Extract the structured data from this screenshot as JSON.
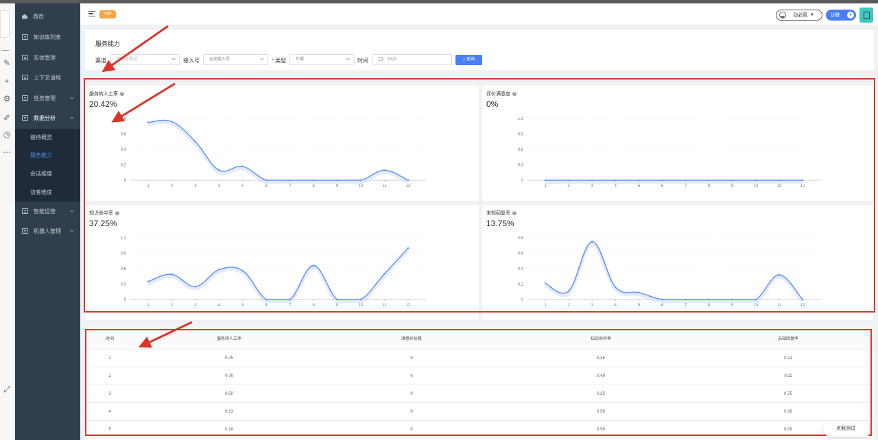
{
  "header": {
    "vip_badge": "VIP",
    "user_name": "动必真",
    "train_label": "训练",
    "train_knob": "★"
  },
  "sidebar": {
    "items": [
      {
        "label": "首页"
      },
      {
        "label": "知识库列表"
      },
      {
        "label": "实体管理"
      },
      {
        "label": "上下文语境"
      },
      {
        "label": "任务管理"
      },
      {
        "label": "数据分析"
      },
      {
        "label": "智能运营"
      },
      {
        "label": "机器人管理"
      }
    ],
    "sub_items": [
      {
        "label": "接待概览"
      },
      {
        "label": "服务能力"
      },
      {
        "label": "会话维度"
      },
      {
        "label": "访客维度"
      }
    ]
  },
  "filter": {
    "title": "服务能力",
    "channel_label": "渠道",
    "channel_placeholder": "请选择渠道",
    "access_label": "接入号",
    "access_value": "全部接入号",
    "type_required": "*",
    "type_label": "类型",
    "type_value": "年报",
    "time_label": "时间",
    "time_value": "2023",
    "query_label": "查询",
    "query_icon": "⌕"
  },
  "charts": [
    {
      "title": "服务转人工率",
      "value": "20.42%",
      "help_icon": "?"
    },
    {
      "title": "评价满意度",
      "value": "0%",
      "help_icon": "?"
    },
    {
      "title": "知识命中率",
      "value": "37.25%",
      "help_icon": "?"
    },
    {
      "title": "未知回复率",
      "value": "13.75%",
      "help_icon": "?"
    }
  ],
  "chart_data": [
    {
      "type": "line",
      "x": [
        1,
        2,
        3,
        4,
        5,
        6,
        7,
        8,
        9,
        10,
        11,
        12
      ],
      "values": [
        0.75,
        0.76,
        0.5,
        0.13,
        0.18,
        0,
        0,
        0,
        0,
        0,
        0.13,
        0
      ],
      "yticks": [
        0,
        0.2,
        0.4,
        0.6,
        0.8
      ],
      "ylim": [
        0,
        0.8
      ],
      "color": "#5b8ff9"
    },
    {
      "type": "line",
      "x": [
        1,
        2,
        3,
        4,
        5,
        6,
        7,
        8,
        9,
        10,
        11,
        12
      ],
      "values": [
        0,
        0,
        0,
        0,
        0,
        0,
        0,
        0,
        0,
        0,
        0,
        0
      ],
      "yticks": [
        0,
        0.3,
        0.6,
        0.9,
        1.2
      ],
      "ylim": [
        0,
        1.2
      ],
      "color": "#5b8ff9"
    },
    {
      "type": "line",
      "x": [
        1,
        2,
        3,
        4,
        5,
        6,
        7,
        8,
        9,
        10,
        11,
        12
      ],
      "values": [
        0.35,
        0.49,
        0.25,
        0.58,
        0.56,
        0,
        0,
        0.66,
        0,
        0,
        0.5,
        1.0
      ],
      "yticks": [
        0,
        0.3,
        0.6,
        0.9,
        1.2
      ],
      "ylim": [
        0,
        1.2
      ],
      "color": "#5b8ff9"
    },
    {
      "type": "line",
      "x": [
        1,
        2,
        3,
        4,
        5,
        6,
        7,
        8,
        9,
        10,
        11,
        12
      ],
      "values": [
        0.21,
        0.11,
        0.75,
        0.16,
        0.09,
        0,
        0,
        0,
        0,
        0,
        0.32,
        0
      ],
      "yticks": [
        0,
        0.2,
        0.4,
        0.6,
        0.8
      ],
      "ylim": [
        0,
        0.8
      ],
      "color": "#5b8ff9"
    }
  ],
  "table": {
    "headers": [
      "时间",
      "服务转人工率",
      "满意评价数",
      "知识命中率",
      "未知回复率"
    ],
    "rows": [
      [
        "1",
        "0.75",
        "0",
        "0.35",
        "0.21"
      ],
      [
        "2",
        "0.76",
        "0",
        "0.49",
        "0.11"
      ],
      [
        "3",
        "0.50",
        "0",
        "0.25",
        "0.75"
      ],
      [
        "4",
        "0.13",
        "0",
        "0.58",
        "0.16"
      ],
      [
        "5",
        "0.18",
        "0",
        "0.56",
        "0.09"
      ]
    ]
  },
  "float_button": "点我测试",
  "colors": {
    "accent": "#4a7ef7",
    "sidebar": "#303e4d",
    "annotation": "#d9352b",
    "line": "#5b8ff9"
  }
}
